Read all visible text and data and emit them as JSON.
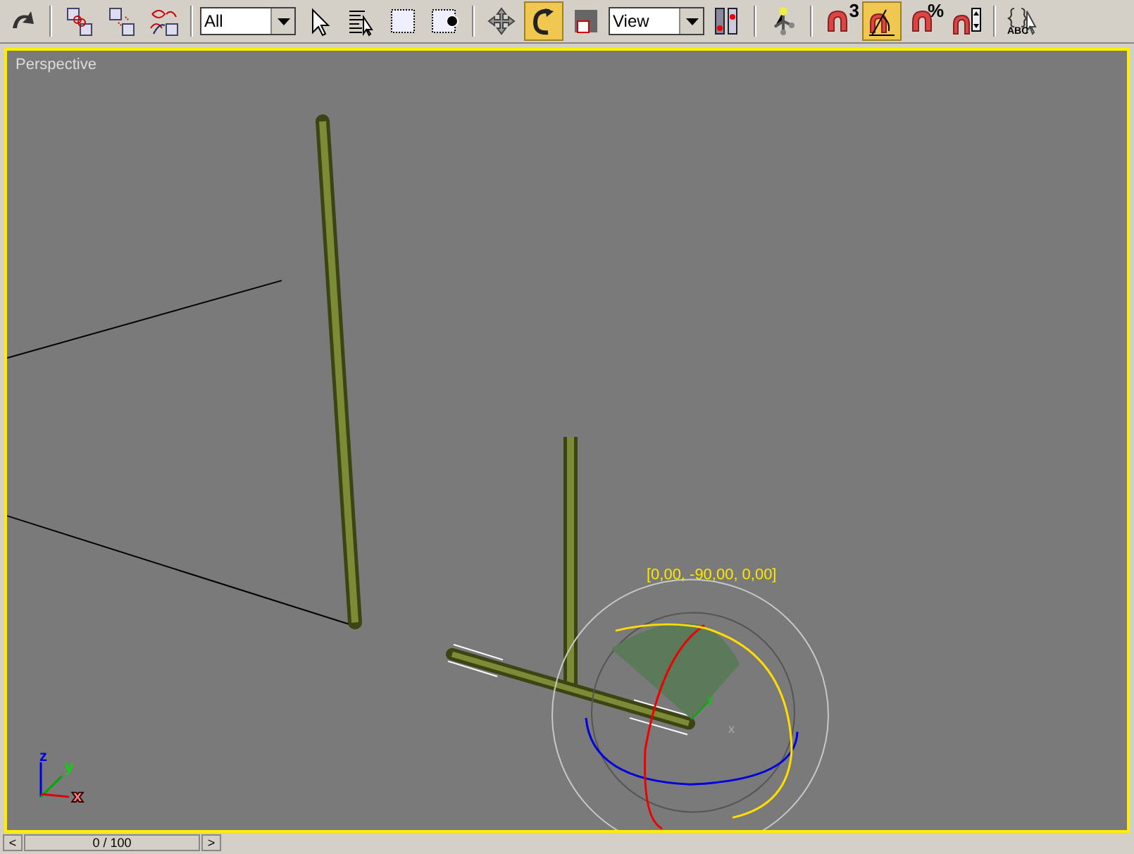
{
  "toolbar": {
    "items": [
      {
        "kind": "button",
        "selected": false
      },
      {
        "kind": "separator"
      },
      {
        "kind": "button",
        "selected": false
      },
      {
        "kind": "button",
        "selected": false
      },
      {
        "kind": "button",
        "selected": false
      },
      {
        "kind": "separator"
      },
      {
        "kind": "dropdown",
        "value": "All"
      },
      {
        "kind": "button",
        "selected": false
      },
      {
        "kind": "button",
        "selected": false
      },
      {
        "kind": "button",
        "selected": false
      },
      {
        "kind": "button",
        "selected": false
      },
      {
        "kind": "separator"
      },
      {
        "kind": "button",
        "selected": false
      },
      {
        "kind": "button",
        "selected": true
      },
      {
        "kind": "button",
        "selected": false
      },
      {
        "kind": "dropdown",
        "value": "View"
      },
      {
        "kind": "button",
        "selected": false
      },
      {
        "kind": "separator"
      },
      {
        "kind": "button",
        "selected": false
      },
      {
        "kind": "separator"
      },
      {
        "kind": "button",
        "selected": false,
        "label": "3"
      },
      {
        "kind": "button",
        "selected": true
      },
      {
        "kind": "button",
        "selected": false,
        "label": "%"
      },
      {
        "kind": "button",
        "selected": false
      },
      {
        "kind": "separator"
      },
      {
        "kind": "button",
        "selected": false,
        "label": "ABC"
      }
    ]
  },
  "viewport": {
    "label": "Perspective",
    "active": true,
    "gizmo_readout": "[0,00, -90,00, 0,00]",
    "gizmo_axes": [
      "y",
      "x"
    ],
    "axis_labels": [
      "z",
      "y",
      "x"
    ]
  },
  "time_slider": {
    "prev": "<",
    "frame": "0 / 100",
    "next": ">"
  }
}
